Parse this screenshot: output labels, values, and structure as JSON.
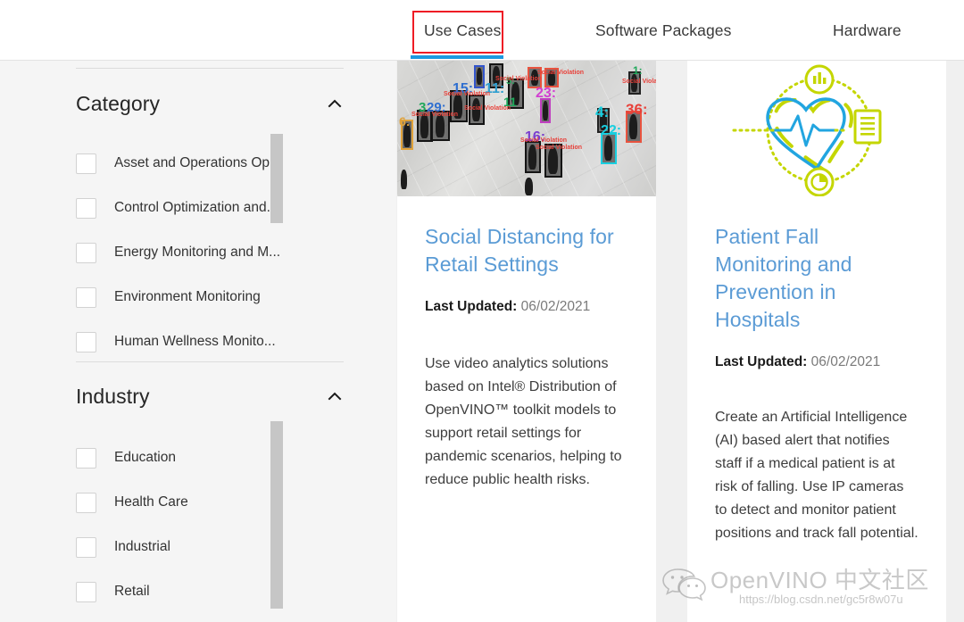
{
  "topnav": {
    "tabs": [
      {
        "label": "Use Cases",
        "active": true
      },
      {
        "label": "Software Packages",
        "active": false
      },
      {
        "label": "Hardware",
        "active": false
      }
    ],
    "active_underline_color": "#1b9ae0",
    "annotation_box_color": "#ee1c25"
  },
  "sidebar": {
    "facets": [
      {
        "title": "Category",
        "toggle_icon": "chevron-up-icon",
        "expanded": true,
        "options": [
          {
            "label": "Asset and Operations Op...",
            "checked": false
          },
          {
            "label": "Control Optimization and...",
            "checked": false
          },
          {
            "label": "Energy Monitoring and M...",
            "checked": false
          },
          {
            "label": "Environment Monitoring",
            "checked": false
          },
          {
            "label": "Human Wellness Monito...",
            "checked": false,
            "clipped": true
          }
        ]
      },
      {
        "title": "Industry",
        "toggle_icon": "chevron-up-icon",
        "expanded": true,
        "options": [
          {
            "label": "Education",
            "checked": false
          },
          {
            "label": "Health Care",
            "checked": false
          },
          {
            "label": "Industrial",
            "checked": false
          },
          {
            "label": "Retail",
            "checked": false
          }
        ]
      }
    ]
  },
  "cards": [
    {
      "title": "Social Distancing for Retail Settings",
      "meta_label": "Last Updated:",
      "meta_value": "06/02/2021",
      "description": "Use video analytics solutions based on Intel® Distribution of OpenVINO™ toolkit models to support retail settings for pandemic scenarios, helping to reduce public health risks.",
      "media": {
        "type": "photo",
        "alt": "social-distancing-detection-overhead-camera",
        "detections": [
          {
            "id": "15:",
            "color": "#2f6fd0"
          },
          {
            "id": "11:",
            "color": "#2f9fd0"
          },
          {
            "id": "23:",
            "color": "#d23fd2"
          },
          {
            "id": "5:",
            "color": "#1fa85a"
          },
          {
            "id": "3:",
            "color": "#1fa85a"
          },
          {
            "id": "29:",
            "color": "#2f6fd0"
          },
          {
            "id": "6:",
            "color": "#e0a23a"
          },
          {
            "id": "16:",
            "color": "#7b3fd0"
          },
          {
            "id": "4:",
            "color": "#19cfe0"
          },
          {
            "id": "22:",
            "color": "#19cfe0"
          },
          {
            "id": "36:",
            "color": "#e8413a"
          }
        ],
        "violation_label": "Social Violation"
      }
    },
    {
      "title": "Patient Fall Monitoring and Prevention in Hospitals",
      "meta_label": "Last Updated:",
      "meta_value": "06/02/2021",
      "description": "Create an Artificial Intelligence (AI) based alert that notifies staff if a medical patient is at risk of falling. Use IP cameras to detect and monitor patient positions and track fall potential.",
      "media": {
        "type": "illustration",
        "alt": "heart-ecg-monitoring-icon",
        "colors": {
          "accent_green": "#c4d600",
          "accent_blue": "#22a5e0"
        },
        "sub_icons": [
          "bar-chart-icon",
          "pie-chart-icon",
          "document-icon"
        ]
      }
    }
  ],
  "watermark": {
    "icon": "wechat-icon",
    "text": "OpenVINO 中文社区",
    "url": "https://blog.csdn.net/gc5r8w07u"
  }
}
